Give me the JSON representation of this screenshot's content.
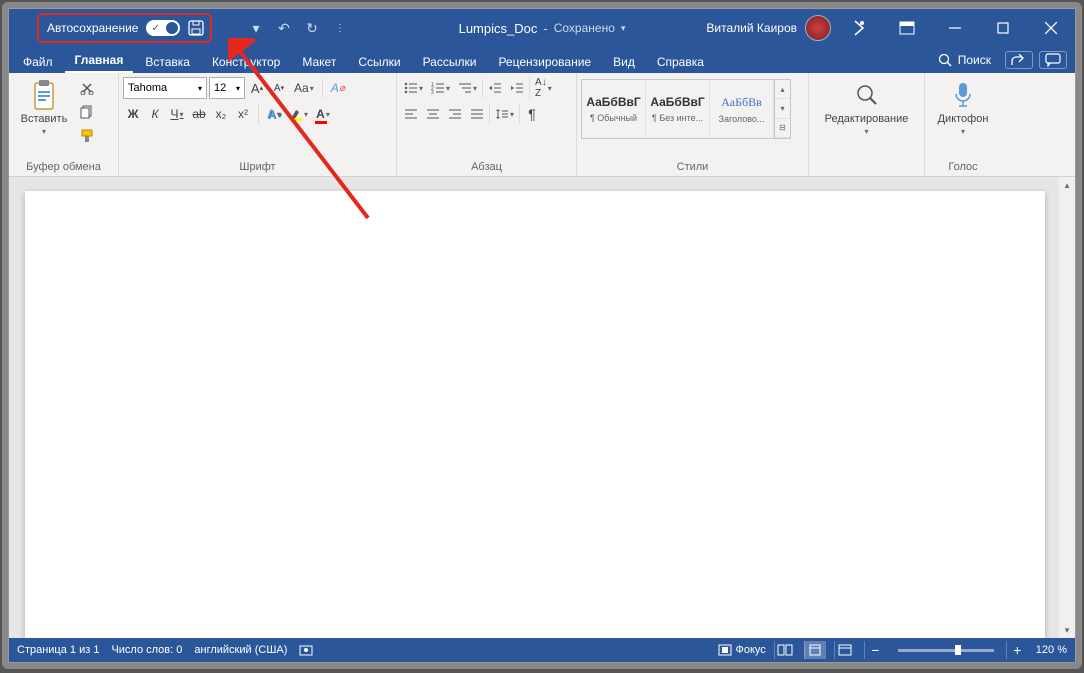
{
  "titlebar": {
    "autosave_label": "Автосохранение",
    "doc_name": "Lumpics_Doc",
    "status": "Сохранено",
    "user_name": "Виталий Каиров"
  },
  "tabs": {
    "items": [
      {
        "label": "Файл"
      },
      {
        "label": "Главная"
      },
      {
        "label": "Вставка"
      },
      {
        "label": "Конструктор"
      },
      {
        "label": "Макет"
      },
      {
        "label": "Ссылки"
      },
      {
        "label": "Рассылки"
      },
      {
        "label": "Рецензирование"
      },
      {
        "label": "Вид"
      },
      {
        "label": "Справка"
      }
    ],
    "search": "Поиск"
  },
  "ribbon": {
    "clipboard": {
      "label": "Буфер обмена",
      "paste": "Вставить"
    },
    "font": {
      "label": "Шрифт",
      "name": "Tahoma",
      "size": "12",
      "bold": "Ж",
      "italic": "К",
      "underline": "Ч",
      "strike": "S",
      "sub": "x₂",
      "sup": "x²"
    },
    "paragraph": {
      "label": "Абзац"
    },
    "styles": {
      "label": "Стили",
      "items": [
        {
          "preview": "АаБбВвГ",
          "name": "¶ Обычный"
        },
        {
          "preview": "АаБбВвГ",
          "name": "¶ Без инте..."
        },
        {
          "preview": "АаБбВв",
          "name": "Заголово..."
        }
      ]
    },
    "editing": {
      "label": "Редактирование"
    },
    "voice": {
      "label": "Голос",
      "dictate": "Диктофон"
    }
  },
  "statusbar": {
    "page": "Страница 1 из 1",
    "words": "Число слов: 0",
    "lang": "английский (США)",
    "focus": "Фокус",
    "zoom": "120 %"
  }
}
